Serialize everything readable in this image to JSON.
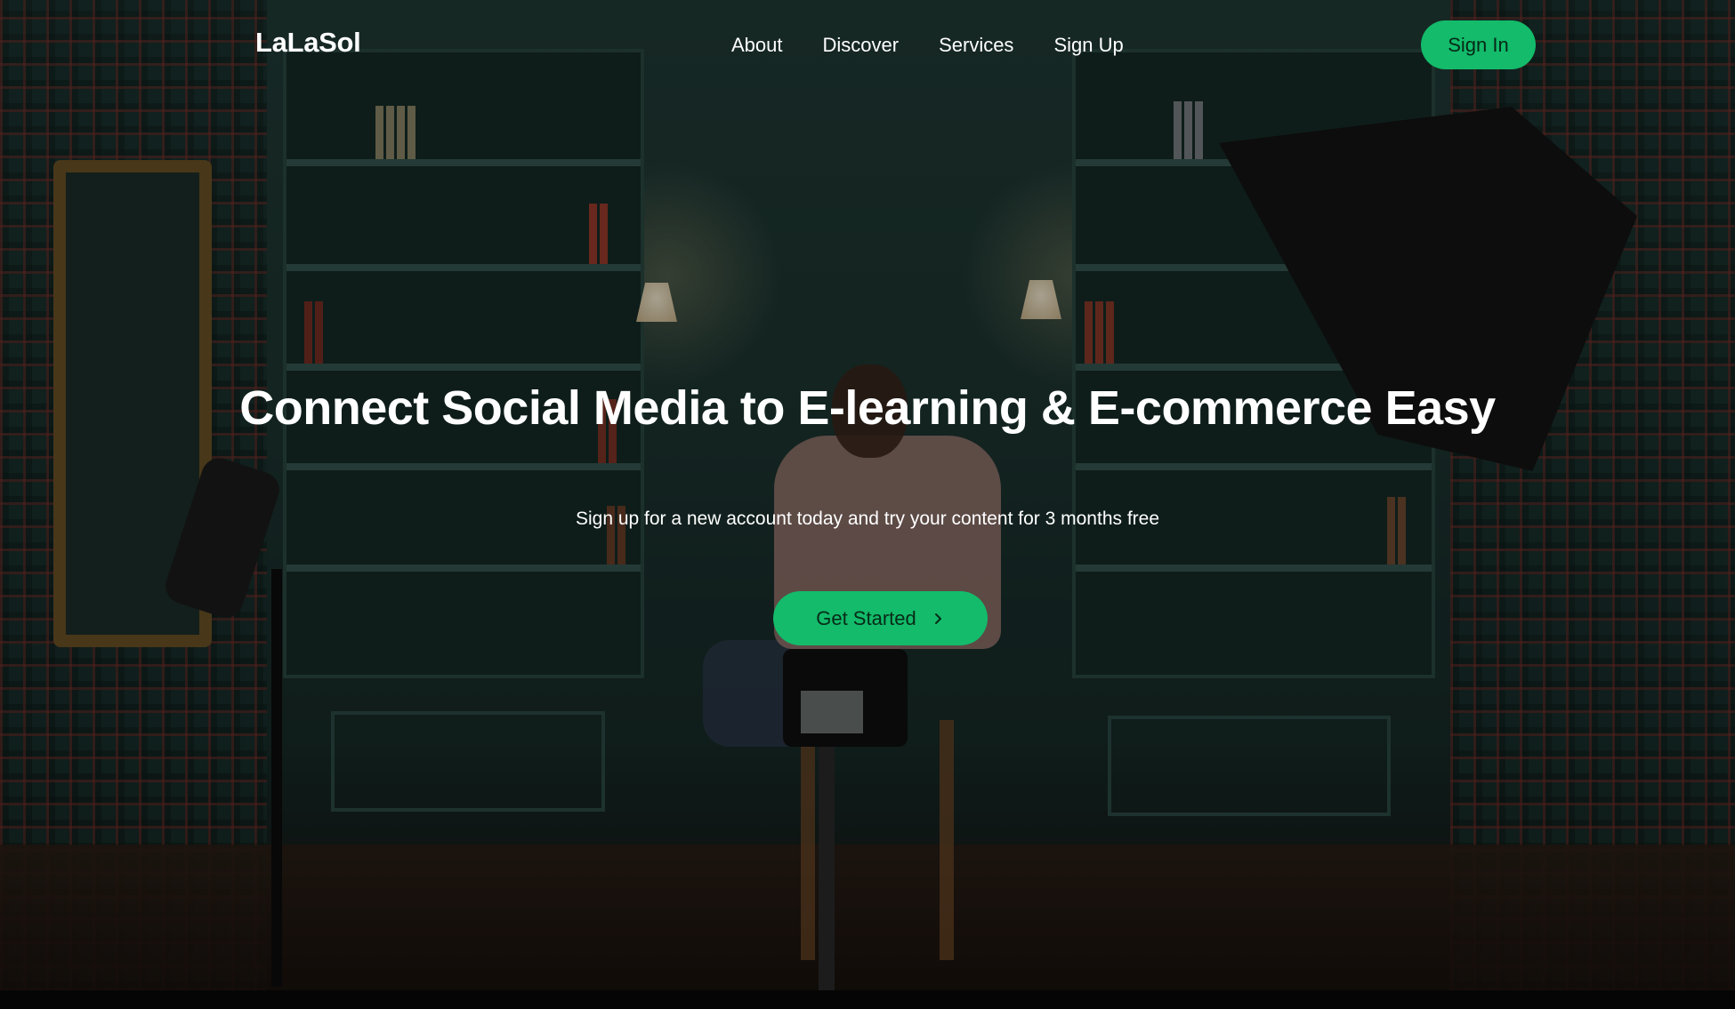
{
  "brand": {
    "name": "LaLaSol",
    "accent_color": "#13bb6a"
  },
  "nav": {
    "links": [
      {
        "label": "About"
      },
      {
        "label": "Discover"
      },
      {
        "label": "Services"
      },
      {
        "label": "Sign Up"
      }
    ],
    "signin_label": "Sign In"
  },
  "hero": {
    "headline": "Connect Social Media to E-learning & E-commerce Easy",
    "subheadline": "Sign up for a new account today and try your content for 3 months free",
    "cta_label": "Get Started",
    "cta_icon": "chevron-right-icon",
    "background": "photo of a smiling man seated on a stool in a dark green studio with bookshelves, lamps and a camera on a tripod"
  }
}
